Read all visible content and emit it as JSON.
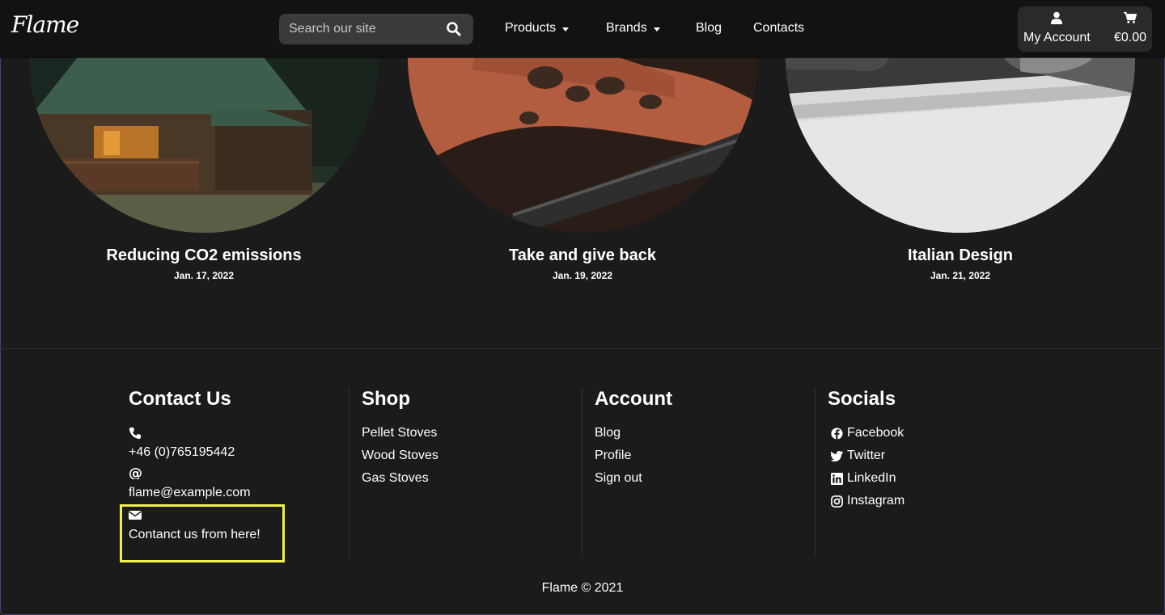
{
  "nav": {
    "logo": "Flame",
    "search_placeholder": "Search our site",
    "links": [
      "Products",
      "Brands",
      "Blog",
      "Contacts"
    ],
    "account_label": "My Account",
    "cart_total": "€0.00"
  },
  "posts": [
    {
      "title": "Reducing CO2 emissions",
      "date": "Jan. 17, 2022"
    },
    {
      "title": "Take and give back",
      "date": "Jan. 19, 2022"
    },
    {
      "title": "Italian Design",
      "date": "Jan. 21, 2022"
    }
  ],
  "footer": {
    "contact": {
      "heading": "Contact Us",
      "phone": "+46 (0)765195442",
      "email": "flame@example.com",
      "form_link": "Contanct us from here!"
    },
    "shop": {
      "heading": "Shop",
      "items": [
        "Pellet Stoves",
        "Wood Stoves",
        "Gas Stoves"
      ]
    },
    "account": {
      "heading": "Account",
      "items": [
        "Blog",
        "Profile",
        "Sign out"
      ]
    },
    "socials": {
      "heading": "Socials",
      "items": [
        "Facebook",
        "Twitter",
        "LinkedIn",
        "Instagram"
      ]
    },
    "copyright": "Flame © 2021"
  },
  "colors": {
    "background": "#1b1b1b",
    "navbar": "#121212",
    "highlight": "#f0f04a"
  }
}
